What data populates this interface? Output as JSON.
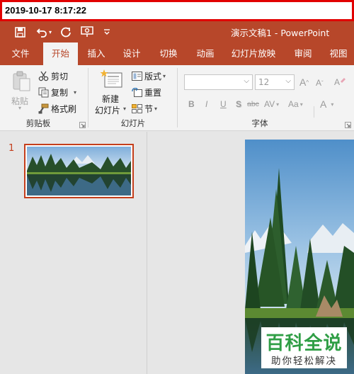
{
  "timestamp": "2019-10-17 8:17:22",
  "window": {
    "title": "演示文稿1  -  PowerPoint"
  },
  "quick_access": [
    "save-icon",
    "undo-icon",
    "redo-icon",
    "present-from-start-icon",
    "customize-qat-icon"
  ],
  "tabs": [
    {
      "label": "文件"
    },
    {
      "label": "开始"
    },
    {
      "label": "插入"
    },
    {
      "label": "设计"
    },
    {
      "label": "切换"
    },
    {
      "label": "动画"
    },
    {
      "label": "幻灯片放映"
    },
    {
      "label": "审阅"
    },
    {
      "label": "视图"
    }
  ],
  "clipboard": {
    "paste_label": "粘贴",
    "cut_label": "剪切",
    "copy_label": "复制",
    "format_painter_label": "格式刷",
    "group_label": "剪贴板"
  },
  "slides_group": {
    "new_slide_line1": "新建",
    "new_slide_line2": "幻灯片",
    "layout_label": "版式",
    "reset_label": "重置",
    "section_label": "节",
    "group_label": "幻灯片"
  },
  "font_group": {
    "font_name": "",
    "font_size": "12",
    "bold": "B",
    "italic": "I",
    "underline": "U",
    "shadow": "S",
    "strike": "abc",
    "spacing": "AV",
    "change_case": "Aa",
    "font_color": "A",
    "grow": "A",
    "shrink": "A",
    "group_label": "字体"
  },
  "slide_panel": {
    "slide_number": "1"
  },
  "watermark": {
    "big": "百科全说",
    "small": "助你轻松解决"
  },
  "colors": {
    "accent": "#b7472a",
    "selection": "#c43e1c",
    "timestamp_border": "#e10000",
    "watermark_green": "#2f9e45"
  }
}
